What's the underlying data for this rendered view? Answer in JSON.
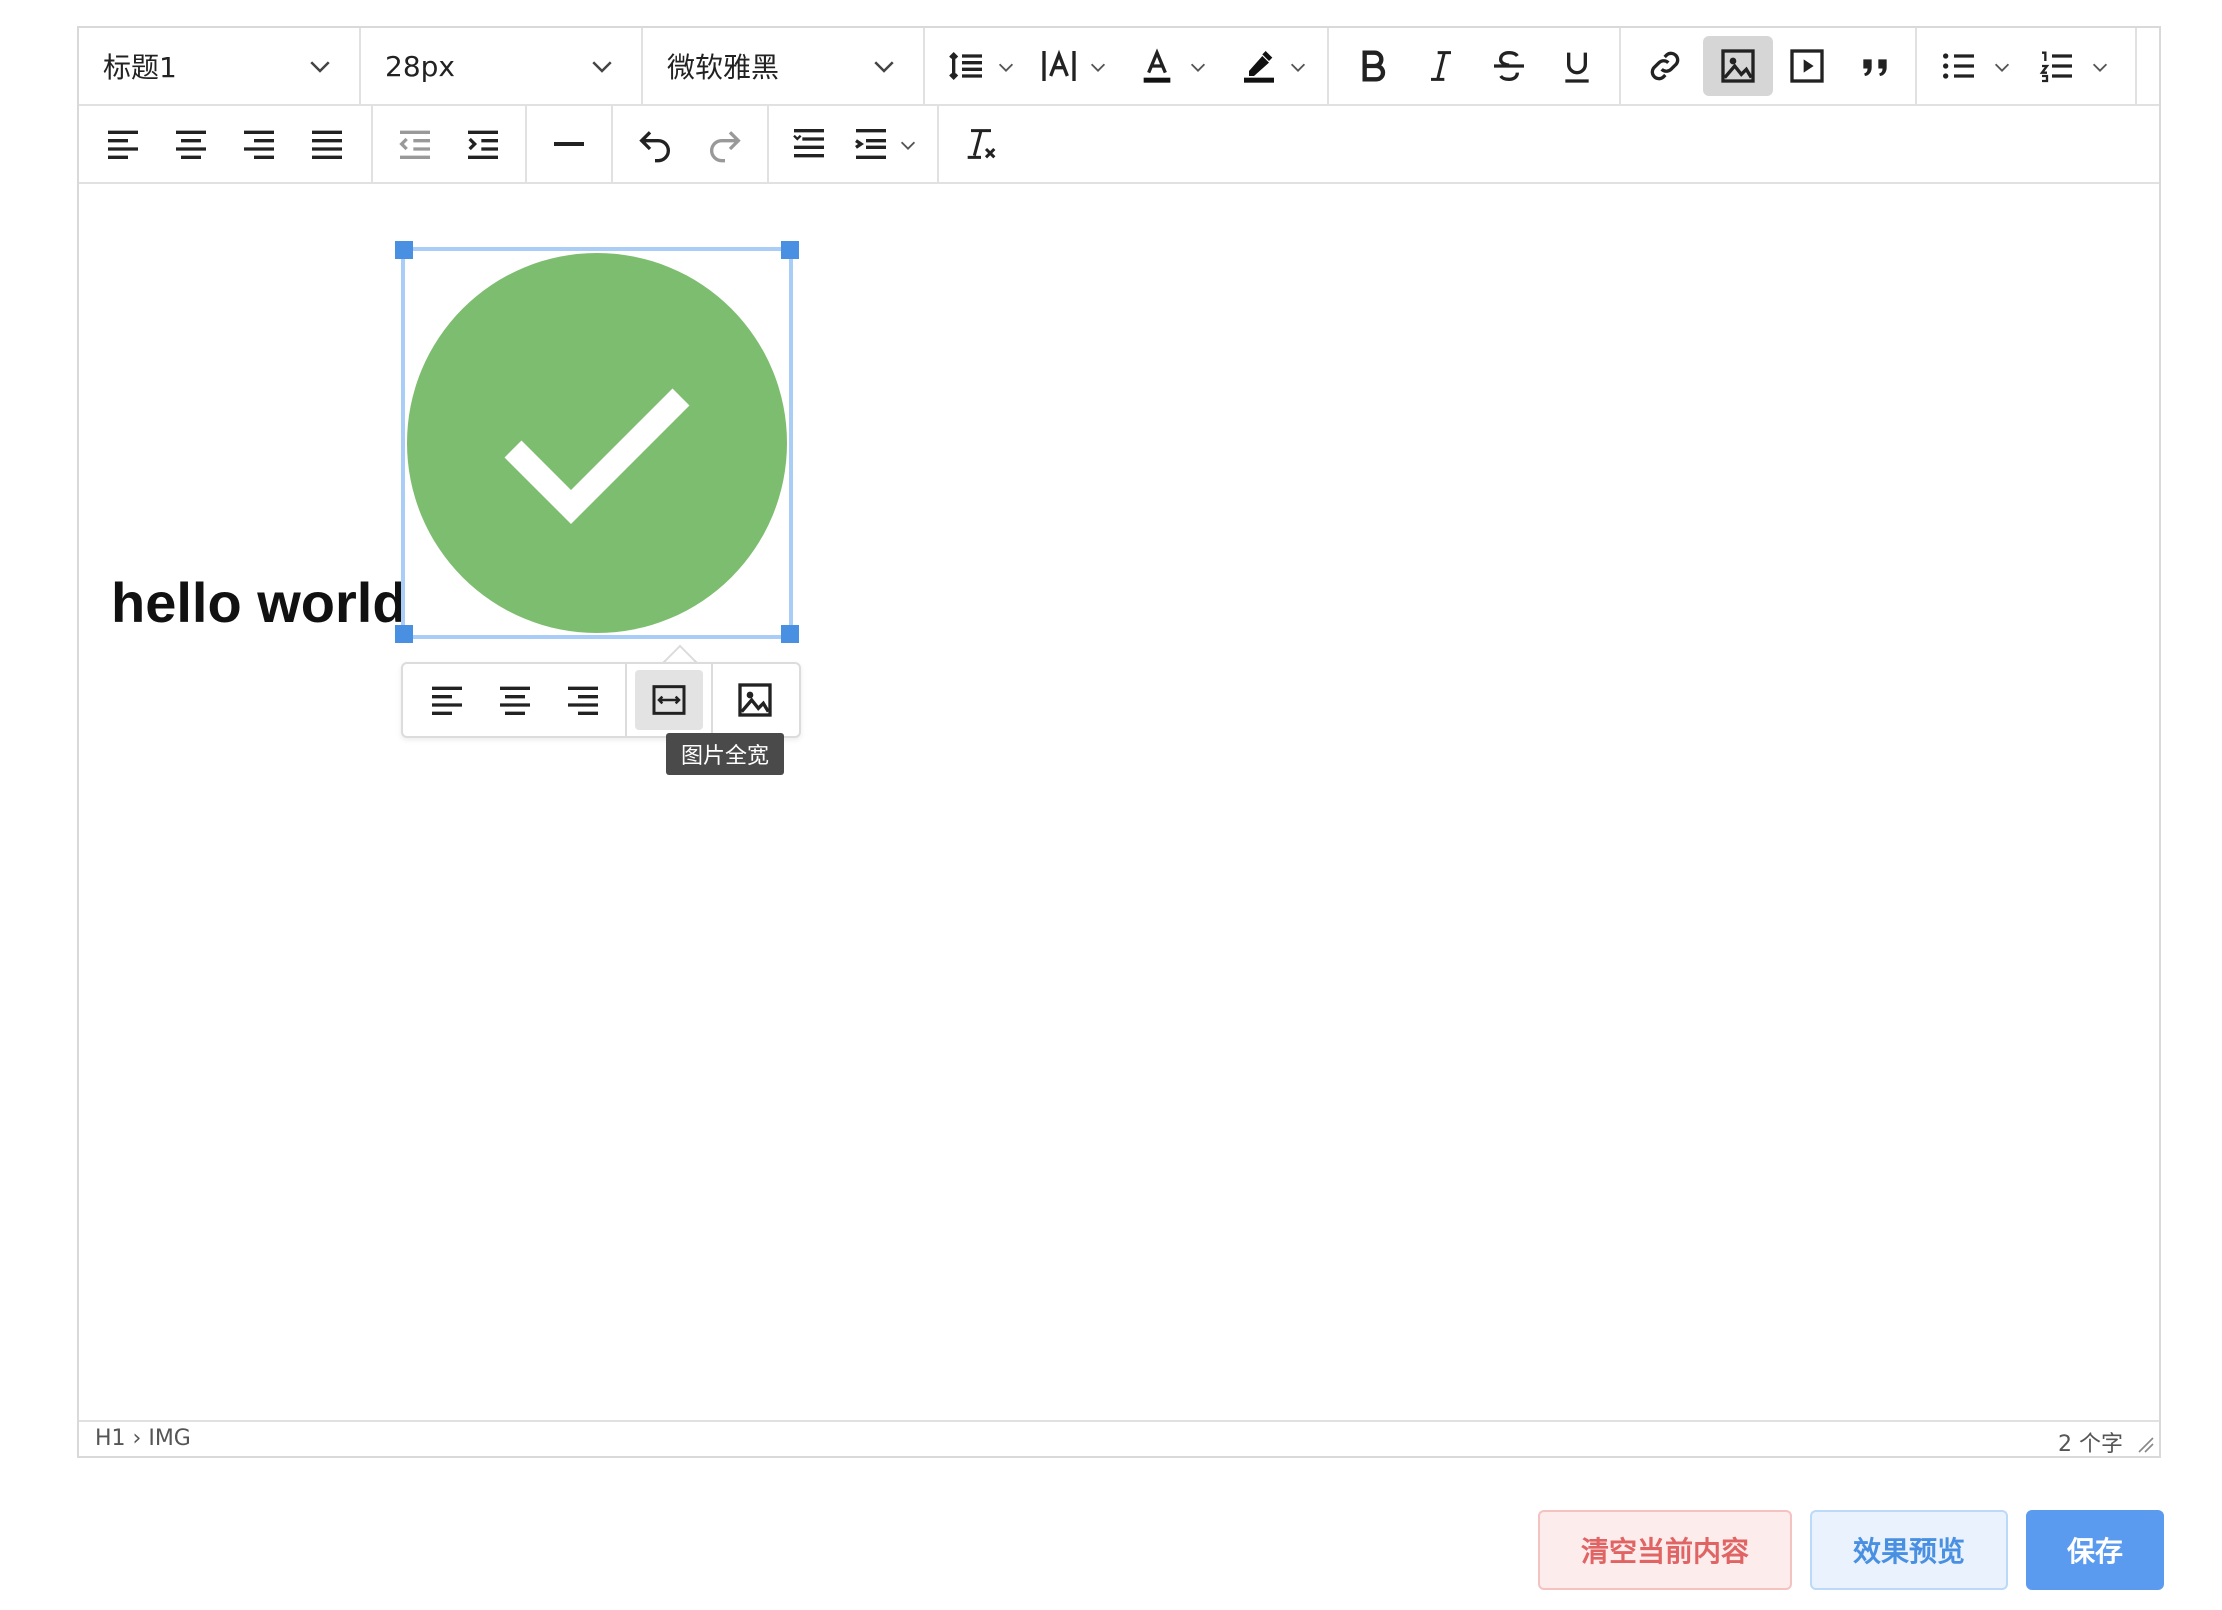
{
  "toolbar": {
    "heading_select": "标题1",
    "size_select": "28px",
    "font_select": "微软雅黑",
    "icons": [
      "line-height",
      "font-size",
      "font-color",
      "highlight",
      "bold",
      "italic",
      "strikethrough",
      "underline",
      "link",
      "image",
      "video",
      "quote",
      "bullet-list",
      "numbered-list",
      "align-left",
      "align-center",
      "align-right",
      "justify",
      "outdent",
      "indent",
      "horizontal-rule",
      "undo",
      "redo",
      "line-spacing",
      "paragraph-spacing",
      "clear-format"
    ],
    "active": "image"
  },
  "content": {
    "text": "hello world"
  },
  "image": {
    "circle_color": "#7dbd6f",
    "check_color": "#ffffff",
    "selection_color": "#a9cdf7",
    "handle_color": "#4a90e2"
  },
  "image_toolbar": {
    "buttons": [
      "align-left",
      "align-center",
      "align-right",
      "full-width",
      "image-options"
    ],
    "hovered": "full-width",
    "tooltip": "图片全宽"
  },
  "status": {
    "path": "H1 › IMG",
    "count": "2 个字"
  },
  "actions": {
    "clear_label": "清空当前内容",
    "preview_label": "效果预览",
    "save_label": "保存",
    "colors": {
      "clear": "#e06464",
      "preview": "#4a90e2",
      "save": "#5a9bf0"
    }
  }
}
